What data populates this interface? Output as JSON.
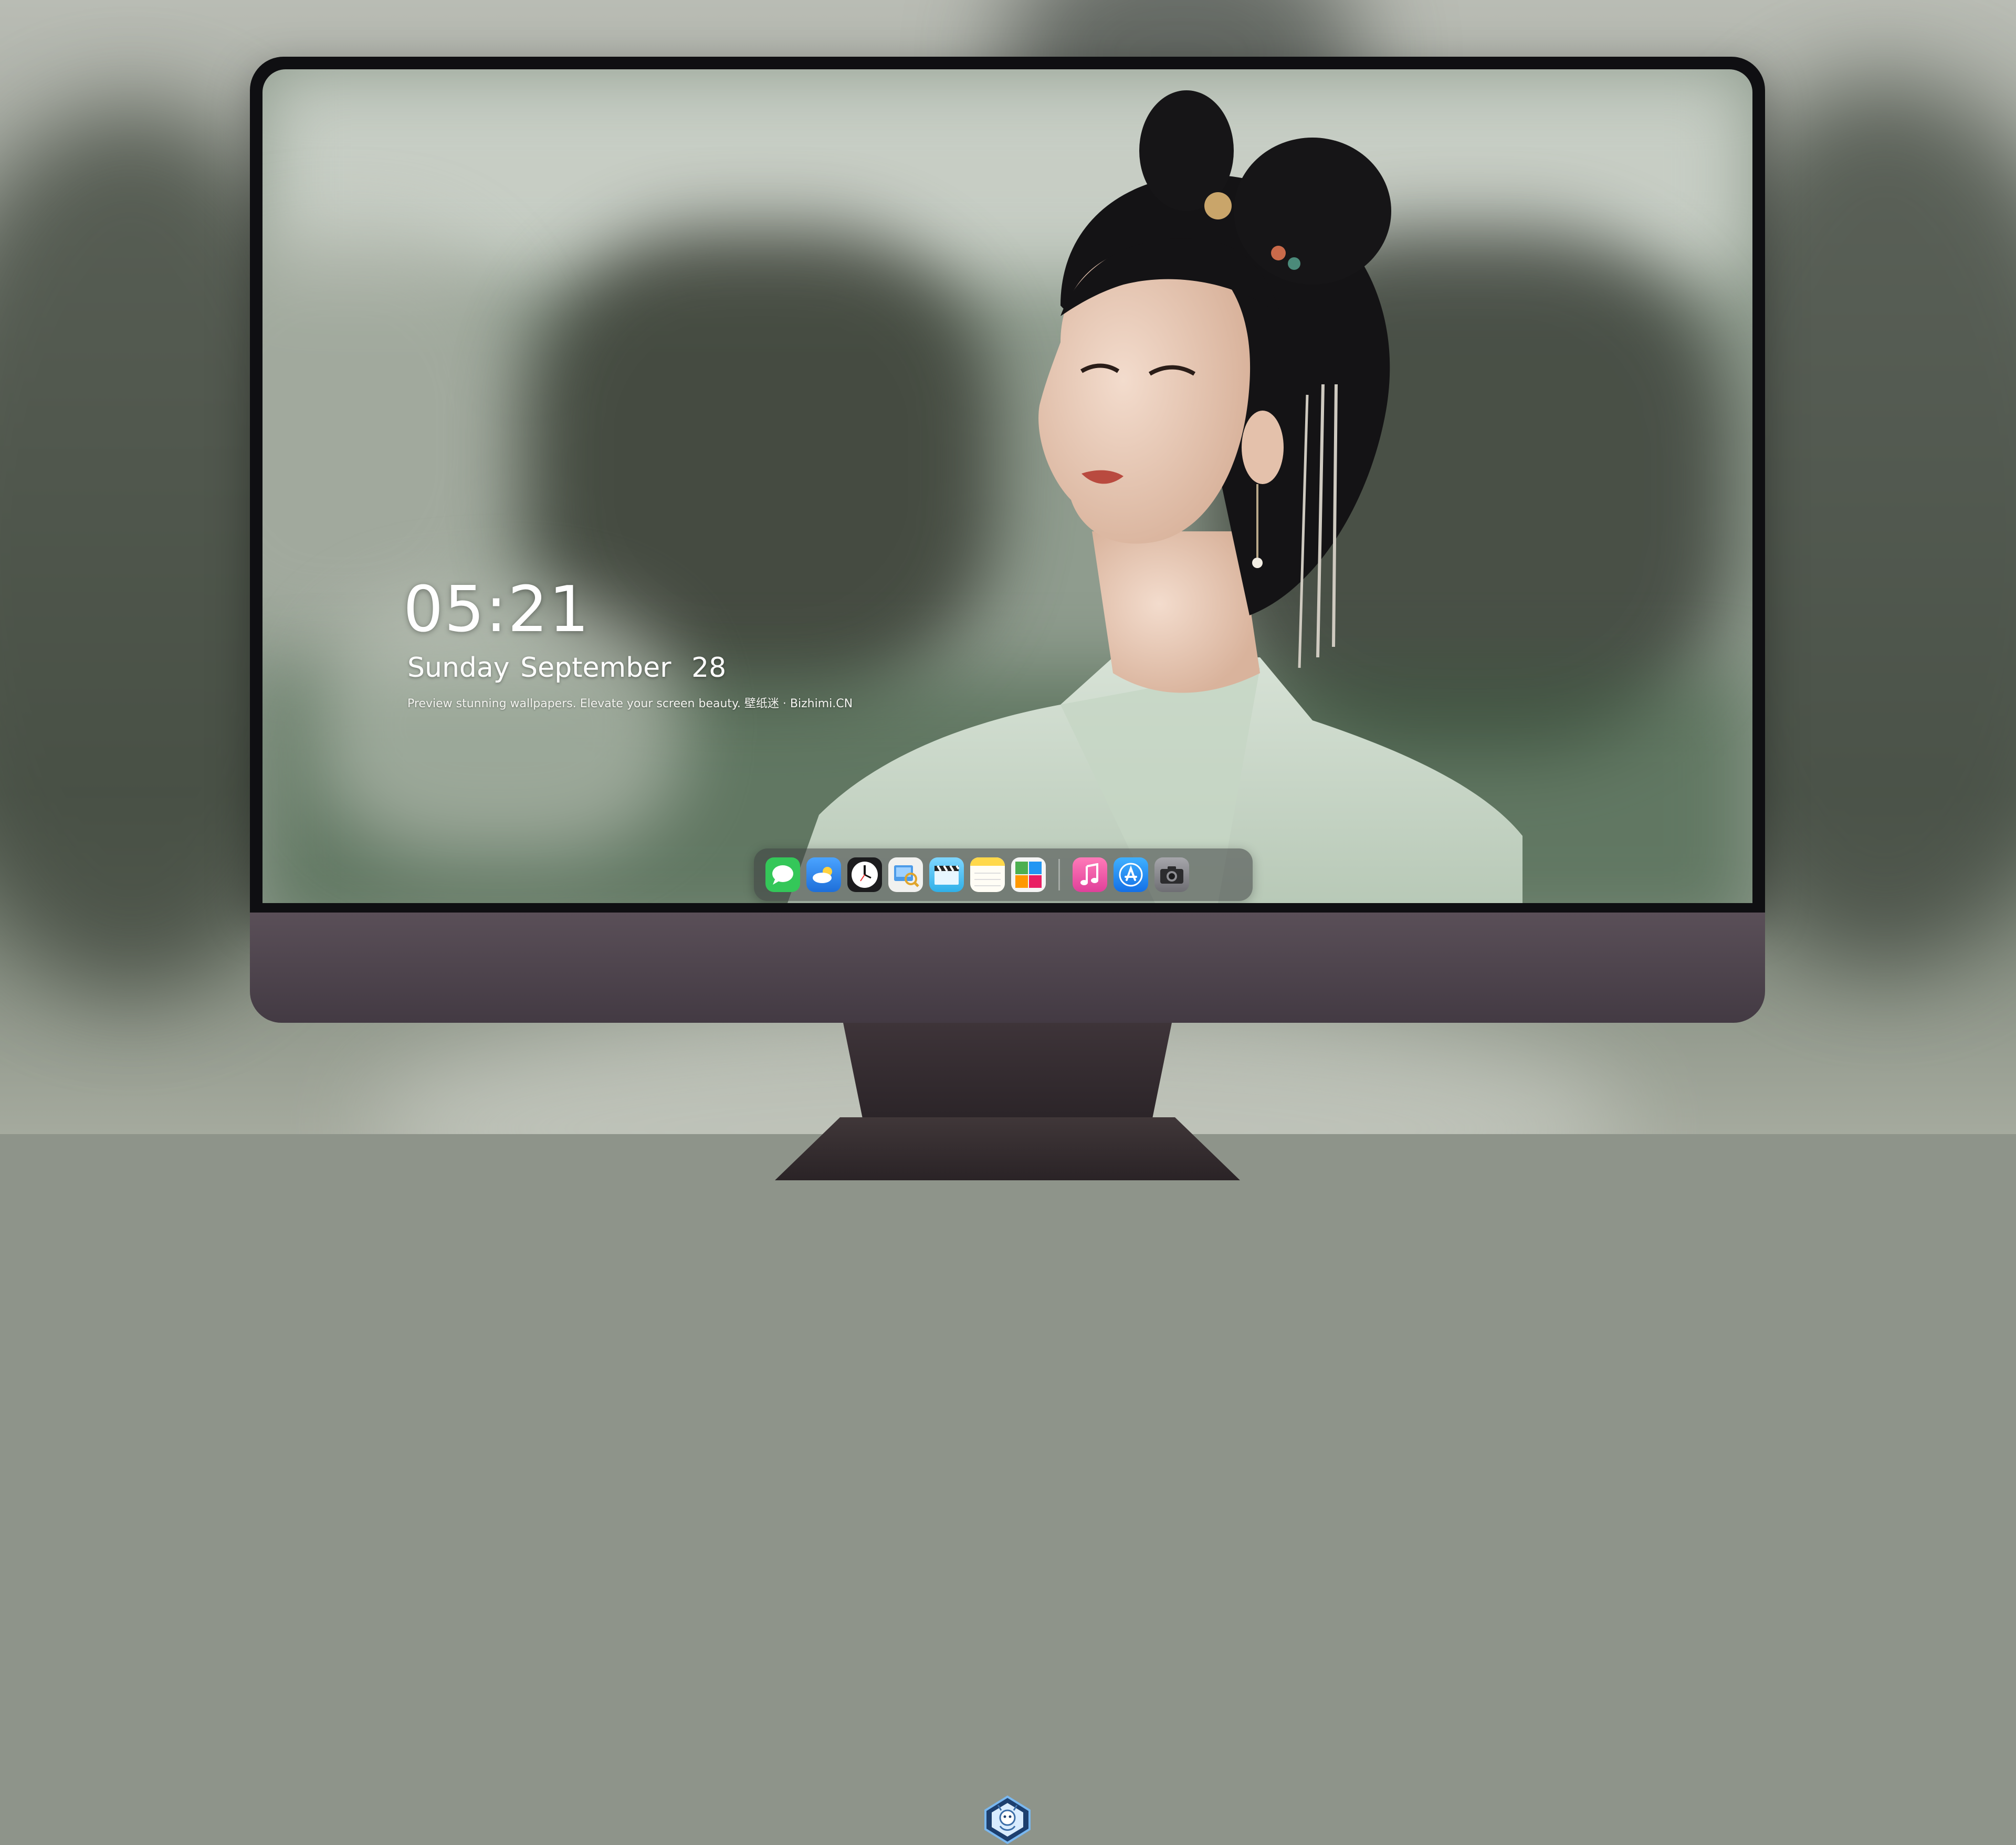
{
  "lockscreen": {
    "time": "05:21",
    "weekday": "Sunday",
    "month": "September",
    "day": "28",
    "tagline": "Preview stunning wallpapers. Elevate your screen beauty. 壁纸迷 · Bizhimi.CN"
  },
  "dock": {
    "apps": [
      {
        "name": "Messages",
        "icon": "messages-icon",
        "color": "#34c759"
      },
      {
        "name": "Weather",
        "icon": "weather-icon",
        "color": "#3a8ef0"
      },
      {
        "name": "Clock",
        "icon": "clock-icon",
        "color": "#1c1c1e"
      },
      {
        "name": "Preview",
        "icon": "preview-icon",
        "color": "#f1f1ef"
      },
      {
        "name": "Clips",
        "icon": "clapperboard-icon",
        "color": "#4fc3f7"
      },
      {
        "name": "Notes",
        "icon": "notes-icon",
        "color": "#ffd84a"
      },
      {
        "name": "Photo Gallery",
        "icon": "gallery-icon",
        "color": "#f5f5f5"
      },
      {
        "name": "Music",
        "icon": "music-icon",
        "color": "#f05fa3"
      },
      {
        "name": "App Store",
        "icon": "app-store-icon",
        "color": "#1b8df5"
      },
      {
        "name": "Camera",
        "icon": "camera-icon",
        "color": "#8e8e93"
      }
    ]
  },
  "monitor": {
    "logo": "dragon-logo-icon",
    "chin_color": "#4d434c"
  }
}
